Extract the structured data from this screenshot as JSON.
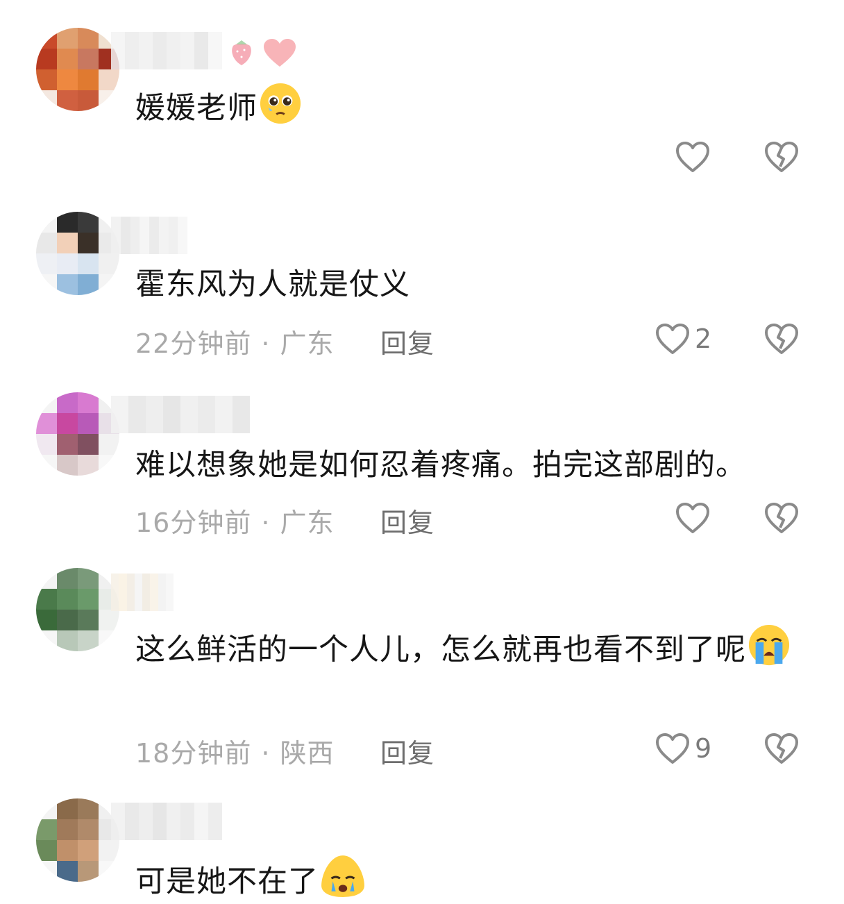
{
  "comments": [
    {
      "text": "媛媛老师",
      "emoji": "pleading-face-emoji",
      "time": "",
      "location": "",
      "reply_label": "",
      "like_count": "",
      "username_emojis": [
        "strawberry-emoji",
        "pink-heart-emoji"
      ]
    },
    {
      "text": "霍东风为人就是仗义",
      "emoji": "",
      "time": "22分钟前",
      "location": "广东",
      "reply_label": "回复",
      "like_count": "2"
    },
    {
      "text": "难以想象她是如何忍着疼痛。拍完这部剧的。",
      "emoji": "",
      "time": "16分钟前",
      "location": "广东",
      "reply_label": "回复",
      "like_count": ""
    },
    {
      "text": "这么鲜活的一个人儿，怎么就再也看不到了呢",
      "emoji": "loudly-crying-face-emoji",
      "time": "18分钟前",
      "location": "陕西",
      "reply_label": "回复",
      "like_count": "9"
    },
    {
      "text": "可是她不在了",
      "emoji": "crying-face-emoji",
      "time": "",
      "location": "",
      "reply_label": "",
      "like_count": ""
    }
  ],
  "separator": "·",
  "colors": {
    "text": "#161616",
    "meta": "#a9a9a9",
    "reply": "#6e6e6e",
    "icon": "#8a8a8a"
  }
}
